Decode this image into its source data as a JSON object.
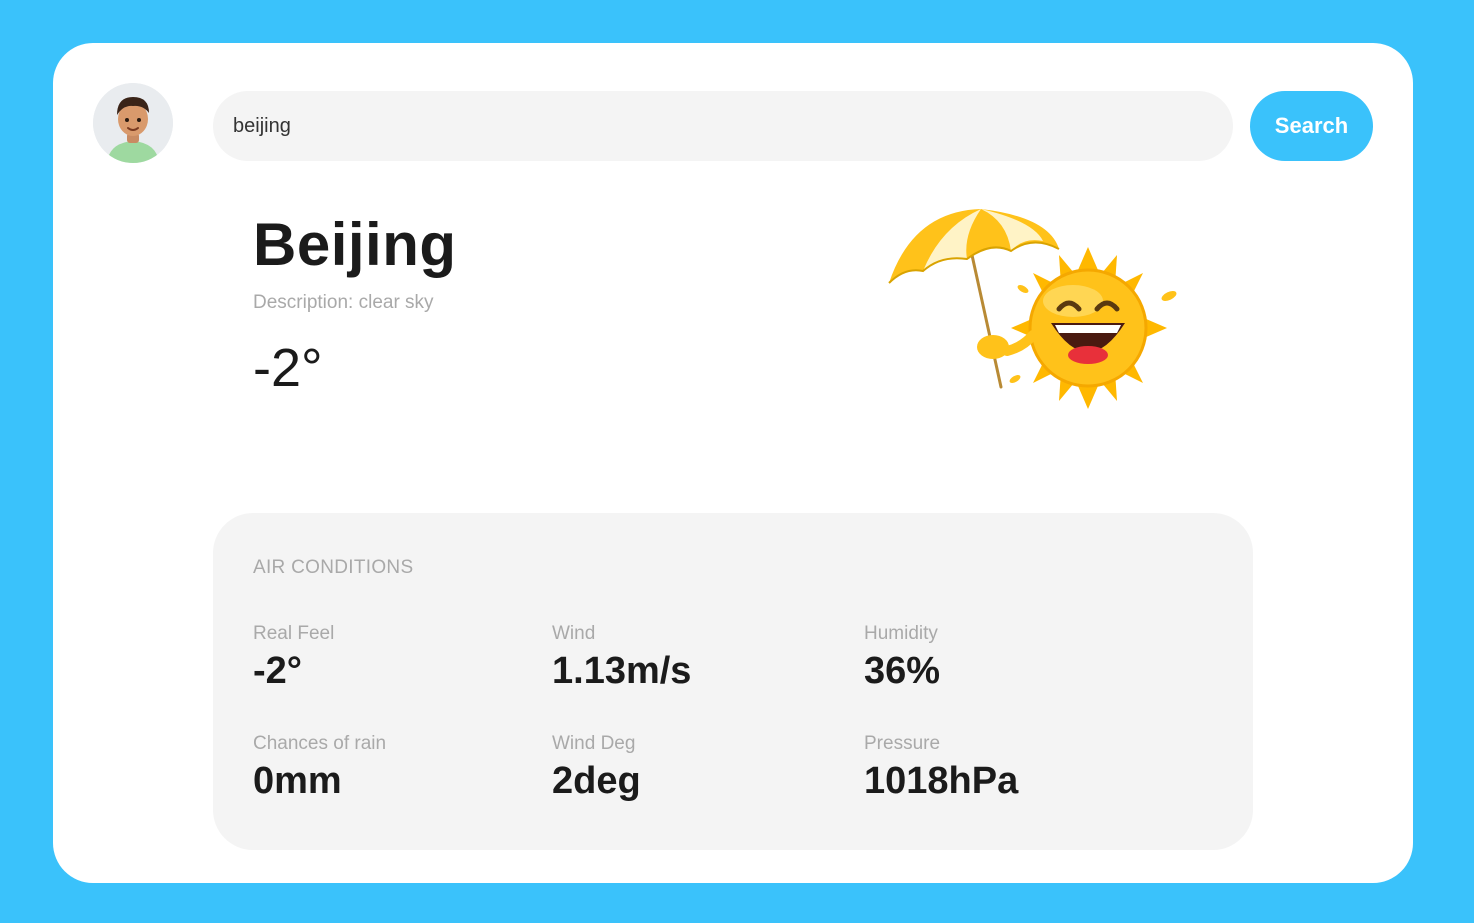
{
  "search": {
    "value": "beijing",
    "button_label": "Search"
  },
  "weather": {
    "city": "Beijing",
    "description": "Description: clear sky",
    "temperature": "-2°"
  },
  "air_conditions": {
    "title": "AIR CONDITIONS",
    "metrics": [
      {
        "label": "Real Feel",
        "value": "-2°"
      },
      {
        "label": "Wind",
        "value": "1.13m/s"
      },
      {
        "label": "Humidity",
        "value": "36%"
      },
      {
        "label": "Chances of rain",
        "value": "0mm"
      },
      {
        "label": "Wind Deg",
        "value": "2deg"
      },
      {
        "label": "Pressure",
        "value": "1018hPa"
      }
    ]
  },
  "icons": {
    "avatar": "user-avatar-icon",
    "weather": "sun-with-umbrella-icon"
  },
  "colors": {
    "background": "#3ac2fb",
    "accent": "#3ac2fb",
    "card": "#ffffff",
    "panel": "#f4f4f4",
    "muted_text": "#a9a9a9",
    "primary_text": "#1b1b1b"
  }
}
